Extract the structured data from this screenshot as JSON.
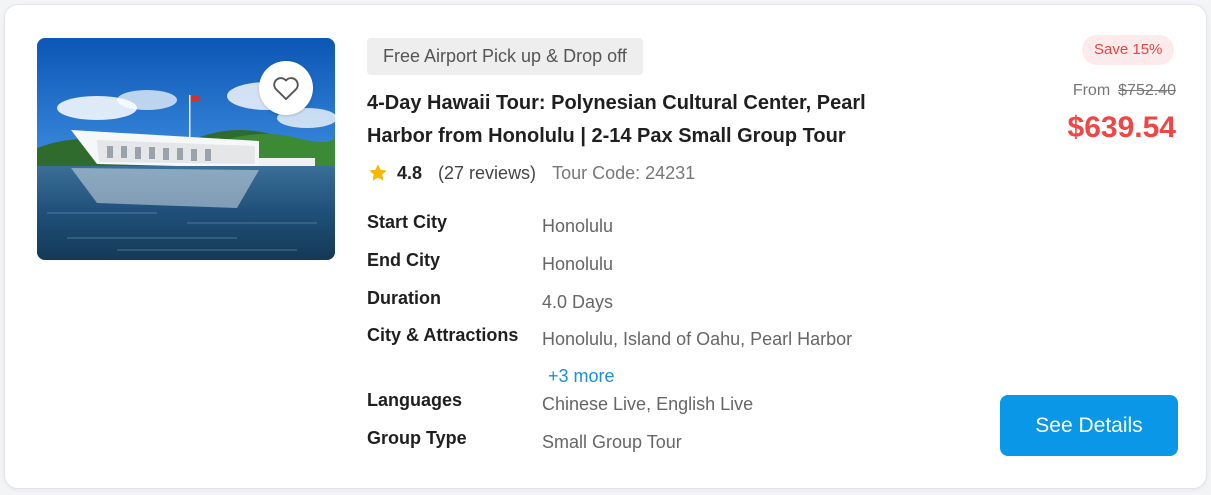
{
  "card": {
    "favorite_icon": "heart-outline-icon",
    "tag": "Free Airport Pick up & Drop off",
    "title": "4-Day Hawaii Tour: Polynesian Cultural Center, Pearl Harbor from Honolulu | 2-14 Pax Small Group Tour",
    "rating": {
      "icon": "star-icon",
      "star_color": "#f5b800",
      "score": "4.8",
      "reviews": "(27 reviews)",
      "tour_code": "Tour Code: 24231"
    },
    "details": [
      {
        "label": "Start City",
        "value": "Honolulu"
      },
      {
        "label": "End City",
        "value": "Honolulu"
      },
      {
        "label": "Duration",
        "value": "4.0 Days"
      },
      {
        "label": "City & Attractions",
        "value": "Honolulu, Island of Oahu, Pearl Harbor",
        "more": "+3 more"
      },
      {
        "label": "Languages",
        "value": "Chinese Live, English Live"
      },
      {
        "label": "Group Type",
        "value": "Small Group Tour"
      }
    ],
    "pricing": {
      "save_badge": "Save 15%",
      "from_label": "From",
      "original_price": "$752.40",
      "price": "$639.54"
    },
    "cta": "See Details"
  },
  "colors": {
    "accent": "#0a97e8",
    "price": "#f04646",
    "link": "#1a8fd6"
  }
}
